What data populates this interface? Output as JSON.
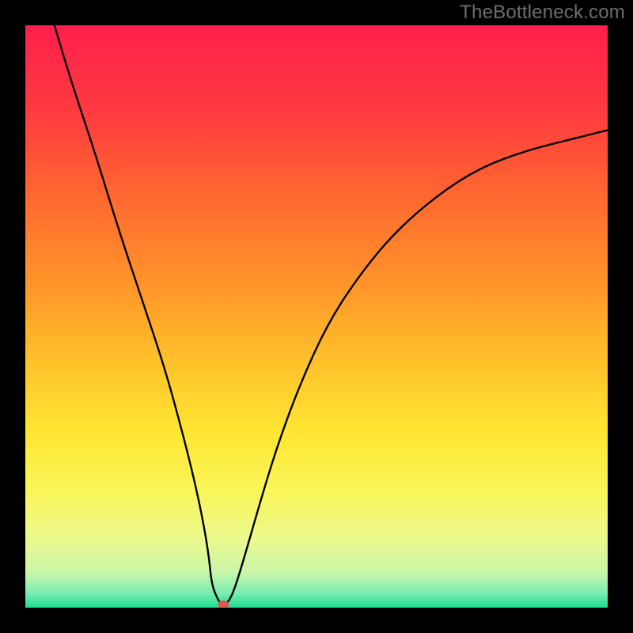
{
  "watermark": "TheBottleneck.com",
  "chart_data": {
    "type": "line",
    "title": "",
    "xlabel": "",
    "ylabel": "",
    "xlim": [
      0,
      100
    ],
    "ylim": [
      0,
      100
    ],
    "series": [
      {
        "name": "curve",
        "x": [
          5,
          8,
          12,
          16,
          20,
          24,
          27,
          29,
          30.5,
          31.5,
          32,
          33,
          33.7,
          34.3,
          35.2,
          36.2,
          38,
          40,
          43,
          47,
          52,
          58,
          64,
          71,
          78,
          86,
          94,
          100
        ],
        "values": [
          100,
          90,
          78,
          65,
          53,
          41,
          30,
          22,
          15,
          9,
          4,
          1.5,
          0.5,
          0.5,
          1.5,
          4,
          10,
          17,
          27,
          38,
          49,
          58,
          65,
          71,
          75.5,
          78.5,
          80.5,
          82
        ]
      }
    ],
    "marker": {
      "x": 34,
      "y": 0.5,
      "color": "#d65a4d"
    },
    "gradient_stops": [
      {
        "offset": 0.0,
        "color": "#ff1f4b"
      },
      {
        "offset": 0.15,
        "color": "#ff3b3f"
      },
      {
        "offset": 0.3,
        "color": "#ff6a2f"
      },
      {
        "offset": 0.45,
        "color": "#ff962a"
      },
      {
        "offset": 0.58,
        "color": "#ffc22a"
      },
      {
        "offset": 0.7,
        "color": "#ffe632"
      },
      {
        "offset": 0.8,
        "color": "#f9f55a"
      },
      {
        "offset": 0.88,
        "color": "#ecf98c"
      },
      {
        "offset": 0.94,
        "color": "#c9f6a9"
      },
      {
        "offset": 0.975,
        "color": "#7aecb2"
      },
      {
        "offset": 1.0,
        "color": "#1adf8e"
      }
    ]
  }
}
